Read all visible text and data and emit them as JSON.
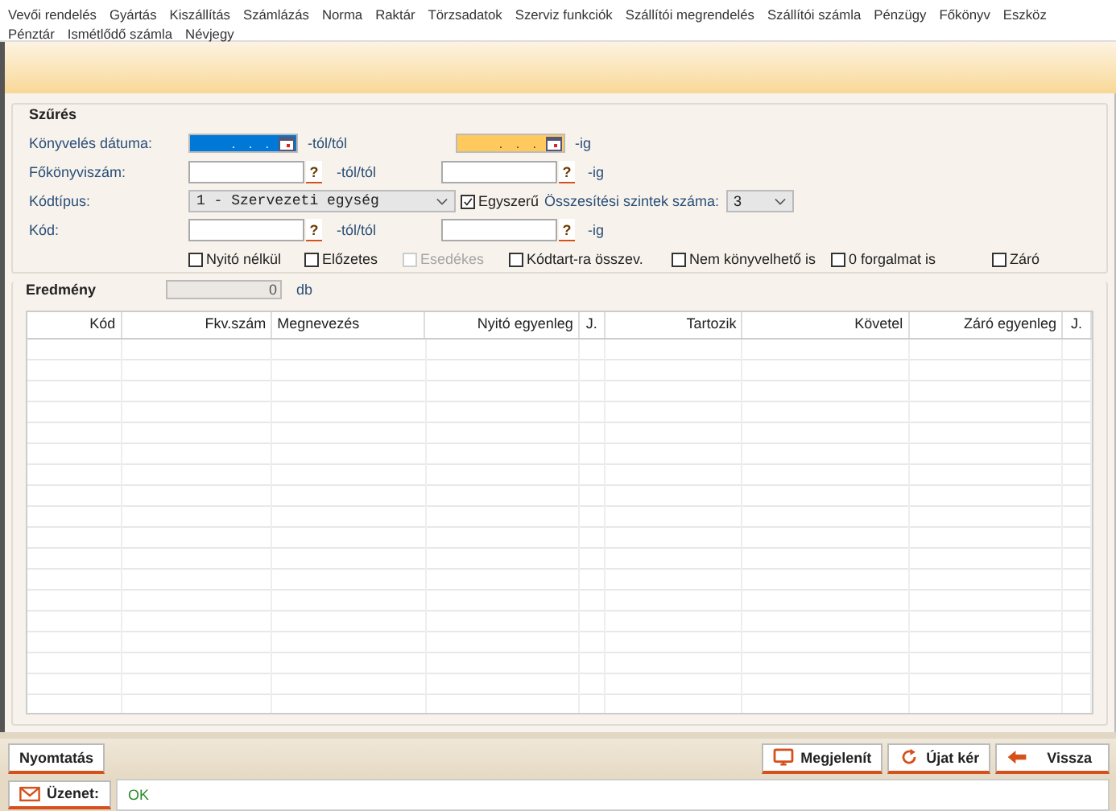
{
  "menu": [
    "Vevői rendelés",
    "Gyártás",
    "Kiszállítás",
    "Számlázás",
    "Norma",
    "Raktár",
    "Törzsadatok",
    "Szerviz funkciók",
    "Szállítói megrendelés",
    "Szállítói számla",
    "Pénzügy",
    "Főkönyv",
    "Eszköz",
    "Pénztár",
    "Ismétlődő számla",
    "Névjegy"
  ],
  "filter": {
    "title": "Szűrés",
    "posting_date": {
      "label": "Könyvelés dátuma:",
      "fields": [
        {
          "value": ". . .",
          "color": "#0078d7"
        },
        {
          "value": ". . .",
          "color": "#ffc95e"
        }
      ],
      "from_suffix": "-tól/tól",
      "to_suffix": "-ig"
    },
    "account": {
      "label": "Főkönyviszám:",
      "from_help": "?",
      "from_suffix": "-tól/tól",
      "to_help": "?",
      "to_suffix": "-ig"
    },
    "code_type": {
      "label": "Kódtípus:",
      "value": "1 - Szervezeti egység"
    },
    "simple": {
      "label": "Egyszerű",
      "checked": true
    },
    "levels": {
      "label": "Összesítési szintek száma:",
      "value": "3"
    },
    "code": {
      "label": "Kód:",
      "from_help": "?",
      "from_suffix": "-tól/tól",
      "to_help": "?",
      "to_suffix": "-ig"
    },
    "options": [
      {
        "label": "Nyitó nélkül",
        "checked": false,
        "disabled": false
      },
      {
        "label": "Előzetes",
        "checked": false,
        "disabled": false
      },
      {
        "label": "Esedékes",
        "checked": false,
        "disabled": true
      },
      {
        "label": "Kódtart-ra összev.",
        "checked": false,
        "disabled": false
      },
      {
        "label": "Nem könyvelhető is",
        "checked": false,
        "disabled": false
      },
      {
        "label": "0 forgalmat is",
        "checked": false,
        "disabled": false
      },
      {
        "label": "Záró",
        "checked": false,
        "disabled": false
      }
    ]
  },
  "result": {
    "title": "Eredmény",
    "count": "0",
    "unit": "db"
  },
  "table": {
    "columns": [
      "Kód",
      "Fkv.szám",
      "Megnevezés",
      "Nyitó egyenleg",
      "J.",
      "Tartozik",
      "Követel",
      "Záró egyenleg",
      "J."
    ]
  },
  "buttons_left": [
    "Nyomtatás"
  ],
  "buttons_right": [
    {
      "label": "Megjelenít",
      "kind": "monitor"
    },
    {
      "label": "Újat kér",
      "kind": "refresh"
    },
    {
      "label": "Vissza",
      "kind": "back"
    }
  ],
  "status": {
    "label": "Üzenet:",
    "message": "OK"
  }
}
